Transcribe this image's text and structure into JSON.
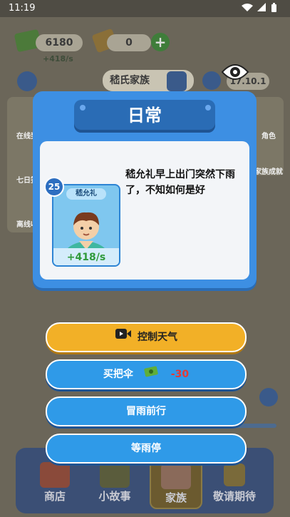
{
  "status_bar": {
    "time": "11:19",
    "icons": "wifi-icon signal-icon battery-icon"
  },
  "resources": {
    "money": "6180",
    "money_rate": "+418/s",
    "gems": "0"
  },
  "family": {
    "name": "嵇氏家族",
    "date": "17.10.1"
  },
  "side_left": [
    {
      "label": "在线奖"
    },
    {
      "label": "七日签"
    },
    {
      "label": "离线收"
    }
  ],
  "side_right": [
    {
      "label": "角色"
    },
    {
      "label": "家族成就"
    }
  ],
  "tabs": [
    {
      "label": "商店"
    },
    {
      "label": "小故事"
    },
    {
      "label": "家族"
    },
    {
      "label": "敬请期待"
    }
  ],
  "modal": {
    "title": "日常",
    "level": "25",
    "character_name": "嵇允礼",
    "character_rate": "+418/s",
    "story": "嵇允礼早上出门突然下雨了，不知如何是好"
  },
  "options": {
    "control_weather": "控制天气",
    "buy_umbrella": "买把伞",
    "buy_umbrella_cost": "-30",
    "go_in_rain": "冒雨前行",
    "wait_rain": "等雨停"
  },
  "colors": {
    "modal_blue": "#3d8fe3",
    "option_blue": "#2f9ae8",
    "option_yellow": "#f2b027",
    "cost_red": "#e53935",
    "rate_green": "#2f9a3a"
  }
}
